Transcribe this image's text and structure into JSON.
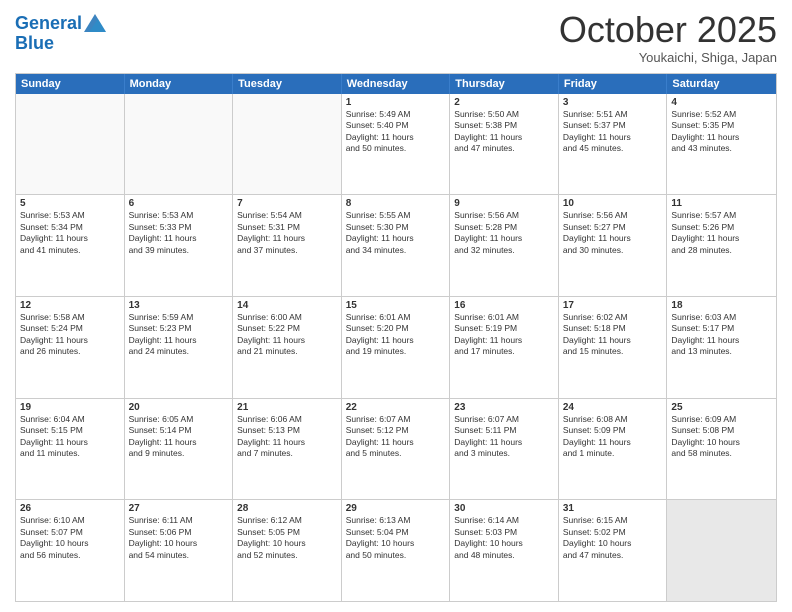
{
  "header": {
    "logo_line1": "General",
    "logo_line2": "Blue",
    "month": "October 2025",
    "location": "Youkaichi, Shiga, Japan"
  },
  "day_headers": [
    "Sunday",
    "Monday",
    "Tuesday",
    "Wednesday",
    "Thursday",
    "Friday",
    "Saturday"
  ],
  "weeks": [
    [
      {
        "num": "",
        "info": ""
      },
      {
        "num": "",
        "info": ""
      },
      {
        "num": "",
        "info": ""
      },
      {
        "num": "1",
        "info": "Sunrise: 5:49 AM\nSunset: 5:40 PM\nDaylight: 11 hours\nand 50 minutes."
      },
      {
        "num": "2",
        "info": "Sunrise: 5:50 AM\nSunset: 5:38 PM\nDaylight: 11 hours\nand 47 minutes."
      },
      {
        "num": "3",
        "info": "Sunrise: 5:51 AM\nSunset: 5:37 PM\nDaylight: 11 hours\nand 45 minutes."
      },
      {
        "num": "4",
        "info": "Sunrise: 5:52 AM\nSunset: 5:35 PM\nDaylight: 11 hours\nand 43 minutes."
      }
    ],
    [
      {
        "num": "5",
        "info": "Sunrise: 5:53 AM\nSunset: 5:34 PM\nDaylight: 11 hours\nand 41 minutes."
      },
      {
        "num": "6",
        "info": "Sunrise: 5:53 AM\nSunset: 5:33 PM\nDaylight: 11 hours\nand 39 minutes."
      },
      {
        "num": "7",
        "info": "Sunrise: 5:54 AM\nSunset: 5:31 PM\nDaylight: 11 hours\nand 37 minutes."
      },
      {
        "num": "8",
        "info": "Sunrise: 5:55 AM\nSunset: 5:30 PM\nDaylight: 11 hours\nand 34 minutes."
      },
      {
        "num": "9",
        "info": "Sunrise: 5:56 AM\nSunset: 5:28 PM\nDaylight: 11 hours\nand 32 minutes."
      },
      {
        "num": "10",
        "info": "Sunrise: 5:56 AM\nSunset: 5:27 PM\nDaylight: 11 hours\nand 30 minutes."
      },
      {
        "num": "11",
        "info": "Sunrise: 5:57 AM\nSunset: 5:26 PM\nDaylight: 11 hours\nand 28 minutes."
      }
    ],
    [
      {
        "num": "12",
        "info": "Sunrise: 5:58 AM\nSunset: 5:24 PM\nDaylight: 11 hours\nand 26 minutes."
      },
      {
        "num": "13",
        "info": "Sunrise: 5:59 AM\nSunset: 5:23 PM\nDaylight: 11 hours\nand 24 minutes."
      },
      {
        "num": "14",
        "info": "Sunrise: 6:00 AM\nSunset: 5:22 PM\nDaylight: 11 hours\nand 21 minutes."
      },
      {
        "num": "15",
        "info": "Sunrise: 6:01 AM\nSunset: 5:20 PM\nDaylight: 11 hours\nand 19 minutes."
      },
      {
        "num": "16",
        "info": "Sunrise: 6:01 AM\nSunset: 5:19 PM\nDaylight: 11 hours\nand 17 minutes."
      },
      {
        "num": "17",
        "info": "Sunrise: 6:02 AM\nSunset: 5:18 PM\nDaylight: 11 hours\nand 15 minutes."
      },
      {
        "num": "18",
        "info": "Sunrise: 6:03 AM\nSunset: 5:17 PM\nDaylight: 11 hours\nand 13 minutes."
      }
    ],
    [
      {
        "num": "19",
        "info": "Sunrise: 6:04 AM\nSunset: 5:15 PM\nDaylight: 11 hours\nand 11 minutes."
      },
      {
        "num": "20",
        "info": "Sunrise: 6:05 AM\nSunset: 5:14 PM\nDaylight: 11 hours\nand 9 minutes."
      },
      {
        "num": "21",
        "info": "Sunrise: 6:06 AM\nSunset: 5:13 PM\nDaylight: 11 hours\nand 7 minutes."
      },
      {
        "num": "22",
        "info": "Sunrise: 6:07 AM\nSunset: 5:12 PM\nDaylight: 11 hours\nand 5 minutes."
      },
      {
        "num": "23",
        "info": "Sunrise: 6:07 AM\nSunset: 5:11 PM\nDaylight: 11 hours\nand 3 minutes."
      },
      {
        "num": "24",
        "info": "Sunrise: 6:08 AM\nSunset: 5:09 PM\nDaylight: 11 hours\nand 1 minute."
      },
      {
        "num": "25",
        "info": "Sunrise: 6:09 AM\nSunset: 5:08 PM\nDaylight: 10 hours\nand 58 minutes."
      }
    ],
    [
      {
        "num": "26",
        "info": "Sunrise: 6:10 AM\nSunset: 5:07 PM\nDaylight: 10 hours\nand 56 minutes."
      },
      {
        "num": "27",
        "info": "Sunrise: 6:11 AM\nSunset: 5:06 PM\nDaylight: 10 hours\nand 54 minutes."
      },
      {
        "num": "28",
        "info": "Sunrise: 6:12 AM\nSunset: 5:05 PM\nDaylight: 10 hours\nand 52 minutes."
      },
      {
        "num": "29",
        "info": "Sunrise: 6:13 AM\nSunset: 5:04 PM\nDaylight: 10 hours\nand 50 minutes."
      },
      {
        "num": "30",
        "info": "Sunrise: 6:14 AM\nSunset: 5:03 PM\nDaylight: 10 hours\nand 48 minutes."
      },
      {
        "num": "31",
        "info": "Sunrise: 6:15 AM\nSunset: 5:02 PM\nDaylight: 10 hours\nand 47 minutes."
      },
      {
        "num": "",
        "info": ""
      }
    ]
  ]
}
